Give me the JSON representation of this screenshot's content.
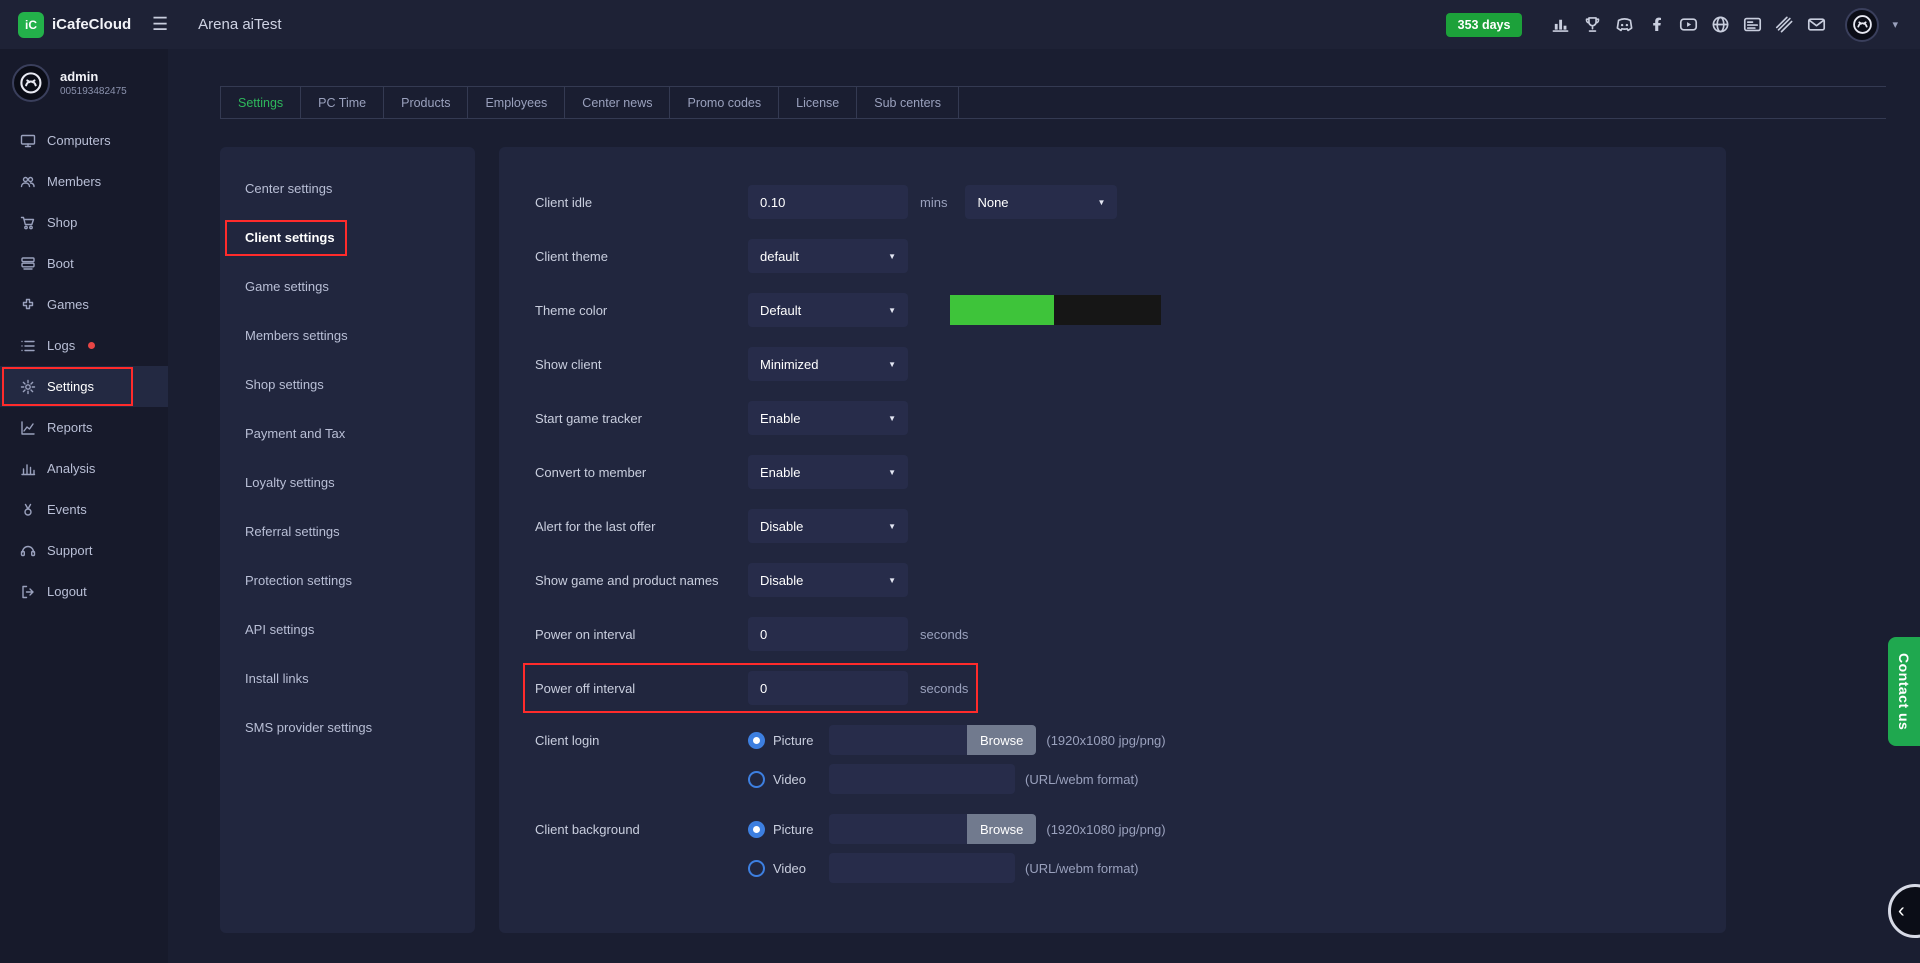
{
  "topbar": {
    "brand": "iCafeCloud",
    "page_title": "Arena aiTest",
    "days_badge": "353 days",
    "icons": [
      "chart-icon",
      "trophy-icon",
      "discord-icon",
      "facebook-icon",
      "youtube-icon",
      "globe-icon",
      "card-icon",
      "stripes-icon",
      "mail-icon"
    ]
  },
  "sidebar": {
    "user_name": "admin",
    "user_id": "005193482475",
    "items": [
      {
        "label": "Computers",
        "icon": "computer-icon"
      },
      {
        "label": "Members",
        "icon": "members-icon"
      },
      {
        "label": "Shop",
        "icon": "cart-icon"
      },
      {
        "label": "Boot",
        "icon": "boot-icon"
      },
      {
        "label": "Games",
        "icon": "games-icon"
      },
      {
        "label": "Logs",
        "icon": "logs-icon",
        "alert_dot": true
      },
      {
        "label": "Settings",
        "icon": "gear-icon",
        "active": true
      },
      {
        "label": "Reports",
        "icon": "reports-icon"
      },
      {
        "label": "Analysis",
        "icon": "analysis-icon"
      },
      {
        "label": "Events",
        "icon": "events-icon"
      },
      {
        "label": "Support",
        "icon": "support-icon"
      },
      {
        "label": "Logout",
        "icon": "logout-icon"
      }
    ]
  },
  "tabs": [
    {
      "label": "Settings",
      "active": true
    },
    {
      "label": "PC Time"
    },
    {
      "label": "Products"
    },
    {
      "label": "Employees"
    },
    {
      "label": "Center news"
    },
    {
      "label": "Promo codes"
    },
    {
      "label": "License"
    },
    {
      "label": "Sub centers"
    }
  ],
  "settings_nav": [
    {
      "label": "Center settings"
    },
    {
      "label": "Client settings",
      "active": true
    },
    {
      "label": "Game settings"
    },
    {
      "label": "Members settings"
    },
    {
      "label": "Shop settings"
    },
    {
      "label": "Payment and Tax"
    },
    {
      "label": "Loyalty settings"
    },
    {
      "label": "Referral settings"
    },
    {
      "label": "Protection settings"
    },
    {
      "label": "API settings"
    },
    {
      "label": "Install links"
    },
    {
      "label": "SMS provider settings"
    }
  ],
  "form": {
    "client_idle": {
      "label": "Client idle",
      "value": "0.10",
      "suffix": "mins",
      "select_value": "None"
    },
    "client_theme": {
      "label": "Client theme",
      "select_value": "default"
    },
    "theme_color": {
      "label": "Theme color",
      "select_value": "Default",
      "swatch_green": "#3ec43a",
      "swatch_black": "#161616"
    },
    "show_client": {
      "label": "Show client",
      "select_value": "Minimized"
    },
    "start_game_tracker": {
      "label": "Start game tracker",
      "select_value": "Enable"
    },
    "convert_to_member": {
      "label": "Convert to member",
      "select_value": "Enable"
    },
    "alert_last_offer": {
      "label": "Alert for the last offer",
      "select_value": "Disable"
    },
    "show_game_product_names": {
      "label": "Show game and product names",
      "select_value": "Disable"
    },
    "power_on_interval": {
      "label": "Power on interval",
      "value": "0",
      "suffix": "seconds"
    },
    "power_off_interval": {
      "label": "Power off interval",
      "value": "0",
      "suffix": "seconds",
      "annotated": true
    },
    "client_login": {
      "label": "Client login",
      "picture_label": "Picture",
      "video_label": "Video",
      "browse_label": "Browse",
      "picture_hint": "(1920x1080 jpg/png)",
      "video_hint": "(URL/webm format)",
      "selected": "Picture"
    },
    "client_background": {
      "label": "Client background",
      "picture_label": "Picture",
      "video_label": "Video",
      "browse_label": "Browse",
      "picture_hint": "(1920x1080 jpg/png)",
      "video_hint": "(URL/webm format)",
      "selected": "Picture"
    }
  },
  "contact_us": {
    "label": "Contact us"
  },
  "colors": {
    "accent_green": "#2eb85c",
    "badge_green": "#1ca13a",
    "annotation_red": "#ff2b2b",
    "radio_blue": "#3d7fe0",
    "swatch_green": "#3ec43a",
    "swatch_black": "#161616"
  }
}
